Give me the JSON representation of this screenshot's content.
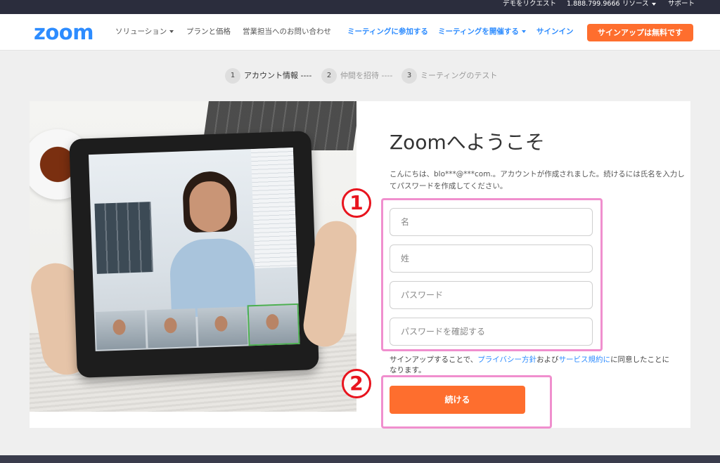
{
  "topbar": {
    "request_demo": "デモをリクエスト",
    "phone": "1.888.799.9666",
    "resources": "リソース",
    "support": "サポート"
  },
  "nav": {
    "logo": "zoom",
    "solutions": "ソリューション",
    "plans": "プランと価格",
    "contact_sales": "営業担当へのお問い合わせ",
    "join_meeting": "ミーティングに参加する",
    "host_meeting": "ミーティングを開催する",
    "sign_in": "サインイン",
    "sign_up": "サインアップは無料です"
  },
  "steps": [
    {
      "num": "1",
      "label": "アカウント情報 ----"
    },
    {
      "num": "2",
      "label": "仲間を招待 ----"
    },
    {
      "num": "3",
      "label": "ミーティングのテスト"
    }
  ],
  "form": {
    "title": "Zoomへようこそ",
    "welcome": "こんにちは、blo***@***com.。アカウントが作成されました。続けるには氏名を入力してパスワードを作成してください。",
    "first_name_placeholder": "名",
    "last_name_placeholder": "姓",
    "password_placeholder": "パスワード",
    "confirm_password_placeholder": "パスワードを確認する",
    "terms_prefix": "サインアップすることで、",
    "privacy_link": "プライバシー方針",
    "terms_and": "および",
    "tos_link": "サービス規約に",
    "terms_suffix": "に同意したことになります。",
    "continue": "続ける"
  },
  "annotations": {
    "badge_1": "1",
    "badge_2": "2",
    "highlight_color": "#f08fce",
    "badge_color": "#e8141e"
  },
  "colors": {
    "brand_blue": "#2d8cff",
    "accent_orange": "#fe6e2e",
    "topbar": "#2b2d3d"
  }
}
